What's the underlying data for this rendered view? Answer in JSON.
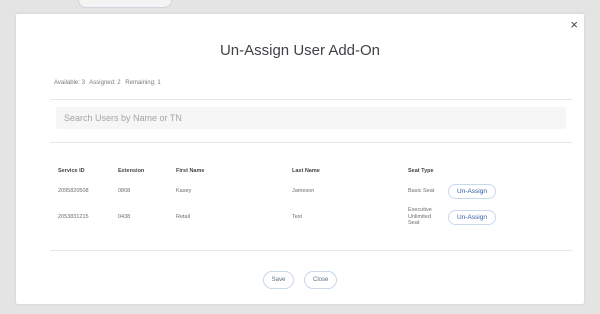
{
  "modal": {
    "title": "Un-Assign User Add-On",
    "close_icon": "×"
  },
  "counts": {
    "available": "Available: 3",
    "assigned": "Assigned: 2",
    "remaining": "Remaining: 1"
  },
  "search": {
    "placeholder": "Search Users by Name or TN"
  },
  "table": {
    "headers": [
      "Service ID",
      "Extension",
      "First Name",
      "Last Name",
      "Seat Type"
    ],
    "rows": [
      {
        "service_id": "2095820508",
        "extension": "0808",
        "first_name": "Kasey",
        "last_name": "Jameson",
        "seat_type_lines": [
          "Basic Seat"
        ],
        "action": "Un-Assign"
      },
      {
        "service_id": "2053831215",
        "extension": "0438",
        "first_name": "Retail",
        "last_name": "Test",
        "seat_type_lines": [
          "Executive",
          "Unlimited",
          "Seat"
        ],
        "action": "Un-Assign"
      }
    ]
  },
  "footer": {
    "save_label": "Save",
    "close_label": "Close"
  }
}
